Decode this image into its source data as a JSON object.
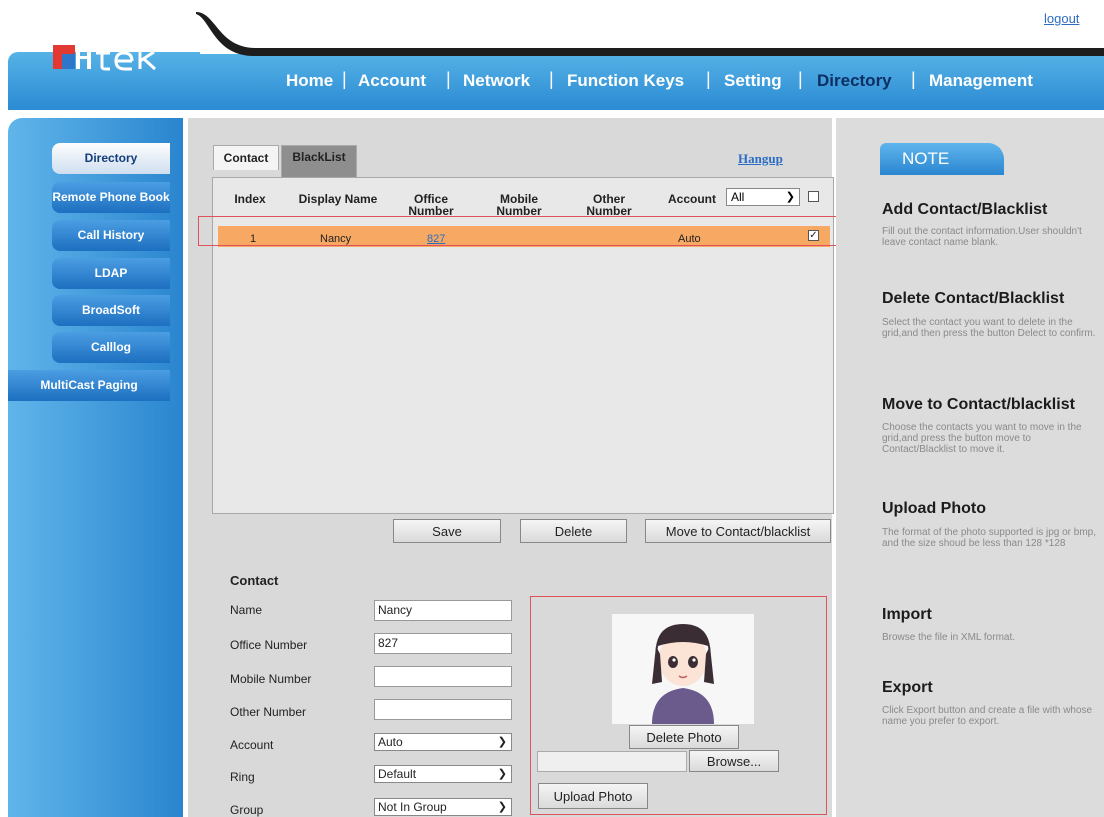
{
  "header": {
    "logout": "logout",
    "nav": [
      "Home",
      "Account",
      "Network",
      "Function Keys",
      "Setting",
      "Directory",
      "Management"
    ]
  },
  "sidebar": {
    "items": [
      "Directory",
      "Remote Phone Book",
      "Call History",
      "LDAP",
      "BroadSoft",
      "Calllog",
      "MultiCast Paging"
    ]
  },
  "tabs": {
    "contact": "Contact",
    "blacklist": "BlackList",
    "hangup": "Hangup"
  },
  "grid": {
    "headers": {
      "index": "Index",
      "display_name": "Display Name",
      "office_number": "Office Number",
      "mobile_number": "Mobile Number",
      "other_number": "Other Number",
      "account": "Account"
    },
    "account_filter": "All",
    "rows": [
      {
        "index": "1",
        "display_name": "Nancy",
        "office_number": "827",
        "mobile_number": "",
        "other_number": "",
        "account": "Auto",
        "checked": "✓"
      }
    ]
  },
  "actions": {
    "save": "Save",
    "delete": "Delete",
    "move": "Move to Contact/blacklist"
  },
  "form": {
    "section_title": "Contact",
    "name_label": "Name",
    "name_value": "Nancy",
    "office_label": "Office Number",
    "office_value": "827",
    "mobile_label": "Mobile Number",
    "mobile_value": "",
    "other_label": "Other Number",
    "other_value": "",
    "account_label": "Account",
    "account_value": "Auto",
    "ring_label": "Ring",
    "ring_value": "Default",
    "group_label": "Group",
    "group_value": "Not In Group"
  },
  "photo": {
    "delete": "Delete Photo",
    "browse": "Browse...",
    "upload": "Upload Photo"
  },
  "note": {
    "tab": "NOTE",
    "sections": [
      {
        "title": "Add Contact/Blacklist",
        "text": "Fill out the contact information.User shouldn't leave contact name blank."
      },
      {
        "title": "Delete Contact/Blacklist",
        "text": "Select the contact you want to delete in the grid,and then press the button Delect to confirm."
      },
      {
        "title": "Move to Contact/blacklist",
        "text": "Choose the contacts you want to move in the grid,and press the button move to Contact/Blacklist to move it."
      },
      {
        "title": "Upload Photo",
        "text": "The format of the photo supported is jpg or bmp, and the size shoud be less than 128 *128"
      },
      {
        "title": "Import",
        "text": "Browse the file in XML format."
      },
      {
        "title": "Export",
        "text": "Click Export button and create a file with whose name you prefer to export."
      }
    ]
  },
  "colors": {
    "accent_blue": "#2b8bd3",
    "selected_row": "#f7a863",
    "highlight_box": "#e0525a"
  }
}
